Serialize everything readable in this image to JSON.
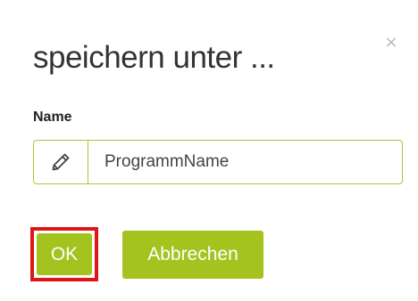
{
  "dialog": {
    "title": "speichern unter ...",
    "close_icon": "close-icon",
    "field": {
      "label": "Name",
      "value": "ProgrammName",
      "icon": "pencil-icon"
    },
    "buttons": {
      "ok_label": "OK",
      "cancel_label": "Abbrechen"
    }
  },
  "colors": {
    "accent": "#a5c31f",
    "input_border": "#a5c936",
    "highlight": "#e01515"
  }
}
